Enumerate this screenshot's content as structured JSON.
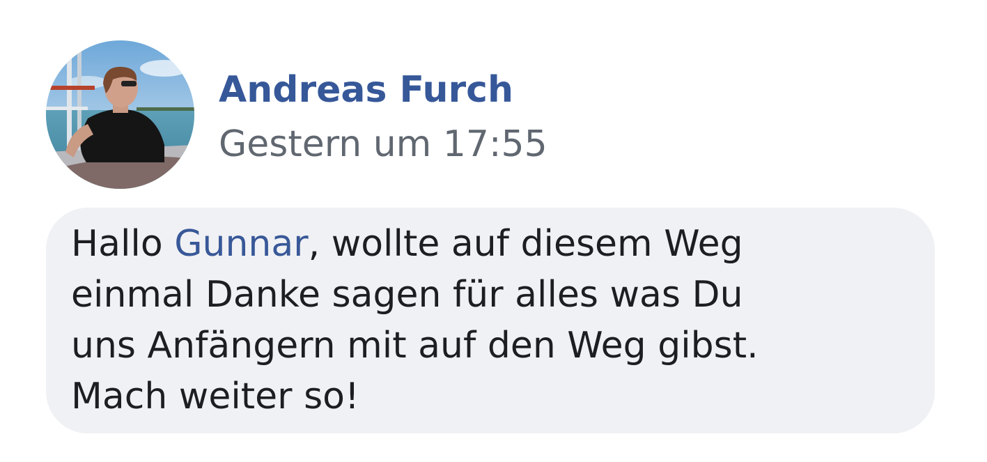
{
  "colors": {
    "link_blue": "#385898",
    "author_blue": "#365899",
    "timestamp_gray": "#606770",
    "text_dark": "#1c1e21",
    "bubble_bg": "#f0f1f4"
  },
  "comment": {
    "avatar_icon": "profile-photo-avatar",
    "author": "Andreas Furch",
    "timestamp": "Gestern um 17:55",
    "message": {
      "greeting": "Hallo ",
      "mention": "Gunnar",
      "line1_rest": ", wollte auf diesem Weg",
      "line2": "einmal Danke sagen für alles was Du",
      "line3": "uns Anfängern mit auf den Weg gibst.",
      "line4": "Mach weiter so!"
    }
  }
}
